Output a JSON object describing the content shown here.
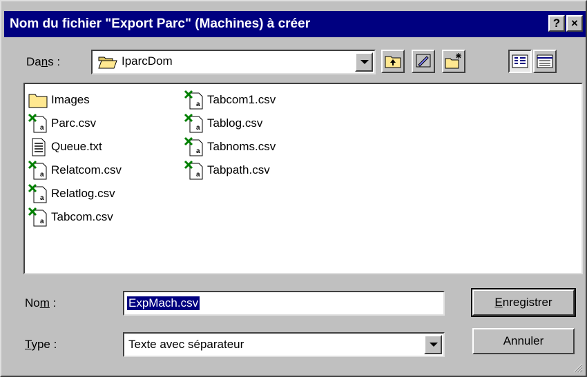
{
  "dialog": {
    "title": "Nom du fichier \"Export Parc\" (Machines) à créer",
    "help_label": "?",
    "close_label": "×"
  },
  "location": {
    "label_pre": "Da",
    "label_mnemonic": "n",
    "label_post": "s :",
    "value": "IparcDom"
  },
  "toolbar": {
    "icons": [
      "up-folder-icon",
      "desktop-icon",
      "new-folder-icon",
      "list-view-icon",
      "details-view-icon"
    ]
  },
  "files": {
    "column1": [
      {
        "name": "Images",
        "icon": "folder-icon"
      },
      {
        "name": "Parc.csv",
        "icon": "excel-file-icon"
      },
      {
        "name": "Queue.txt",
        "icon": "text-file-icon"
      },
      {
        "name": "Relatcom.csv",
        "icon": "excel-file-icon"
      },
      {
        "name": "Relatlog.csv",
        "icon": "excel-file-icon"
      },
      {
        "name": "Tabcom.csv",
        "icon": "excel-file-icon"
      }
    ],
    "column2": [
      {
        "name": "Tabcom1.csv",
        "icon": "excel-file-icon"
      },
      {
        "name": "Tablog.csv",
        "icon": "excel-file-icon"
      },
      {
        "name": "Tabnoms.csv",
        "icon": "excel-file-icon"
      },
      {
        "name": "Tabpath.csv",
        "icon": "excel-file-icon"
      }
    ]
  },
  "filename": {
    "label_pre": "No",
    "label_mnemonic": "m",
    "label_post": " :",
    "value": "ExpMach.csv"
  },
  "filetype": {
    "label_mnemonic": "T",
    "label_post": "ype :",
    "value": "Texte avec séparateur"
  },
  "buttons": {
    "save_mnemonic": "E",
    "save_rest": "nregistrer",
    "cancel": "Annuler"
  }
}
